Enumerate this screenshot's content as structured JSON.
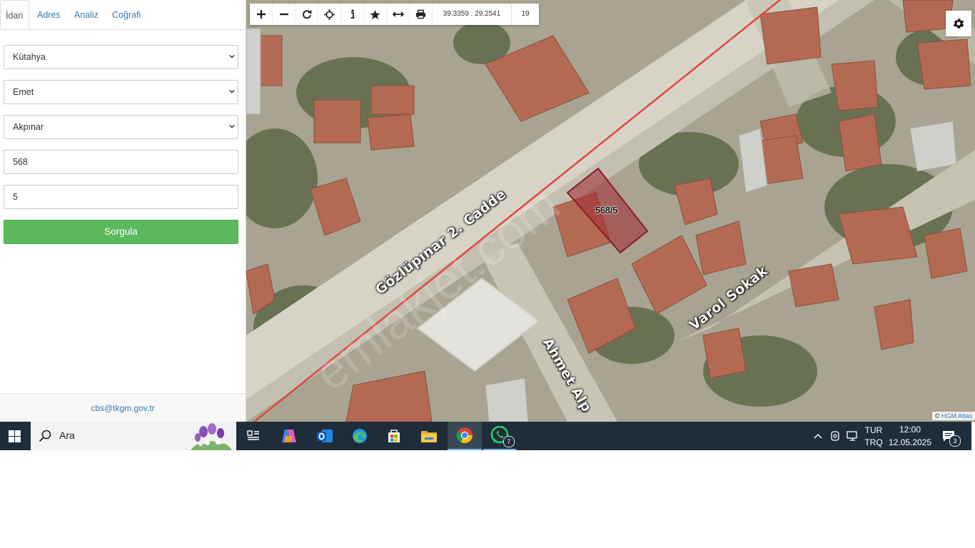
{
  "sidebar": {
    "tabs": [
      {
        "label": "İdari",
        "active": true
      },
      {
        "label": "Adres",
        "active": false
      },
      {
        "label": "Analiz",
        "active": false
      },
      {
        "label": "Coğrafi",
        "active": false
      }
    ],
    "il": "Kütahya",
    "ilce": "Emet",
    "mahalle": "Akpınar",
    "ada": "568",
    "parsel": "5",
    "query_button": "Sorgula",
    "footer_email": "cbs@tkgm.gov.tr"
  },
  "map": {
    "toolbar": {
      "icons": [
        "plus-icon",
        "minus-icon",
        "refresh-icon",
        "locate-icon",
        "info-icon",
        "star-icon",
        "measure-icon",
        "print-icon"
      ],
      "coordinates": "39.3359 : 29.2541",
      "zoom": "19"
    },
    "settings_icon": "gear-icon",
    "labels": {
      "street1": "Gözlüpınar 2. Cadde",
      "street2": "Varol Sokak",
      "street3": "Ahmet Alp",
      "parcel": "568/5"
    },
    "watermark": "emlakjet.com",
    "attribution": {
      "prefix": "©",
      "link": "HGM Atlas"
    },
    "colors": {
      "parcel_outline": "#8b1a2b",
      "boundary_line": "#e0473f"
    }
  },
  "taskbar": {
    "search_placeholder": "Ara",
    "apps": [
      "task-view-icon",
      "copilot-icon",
      "outlook-icon",
      "edge-icon",
      "store-icon",
      "file-explorer-icon",
      "chrome-icon",
      "whatsapp-icon"
    ],
    "whatsapp_badge": "7",
    "lang_top": "TUR",
    "lang_bottom": "TRQ",
    "time": "12:00",
    "date": "12.05.2025",
    "notifications": "3"
  }
}
